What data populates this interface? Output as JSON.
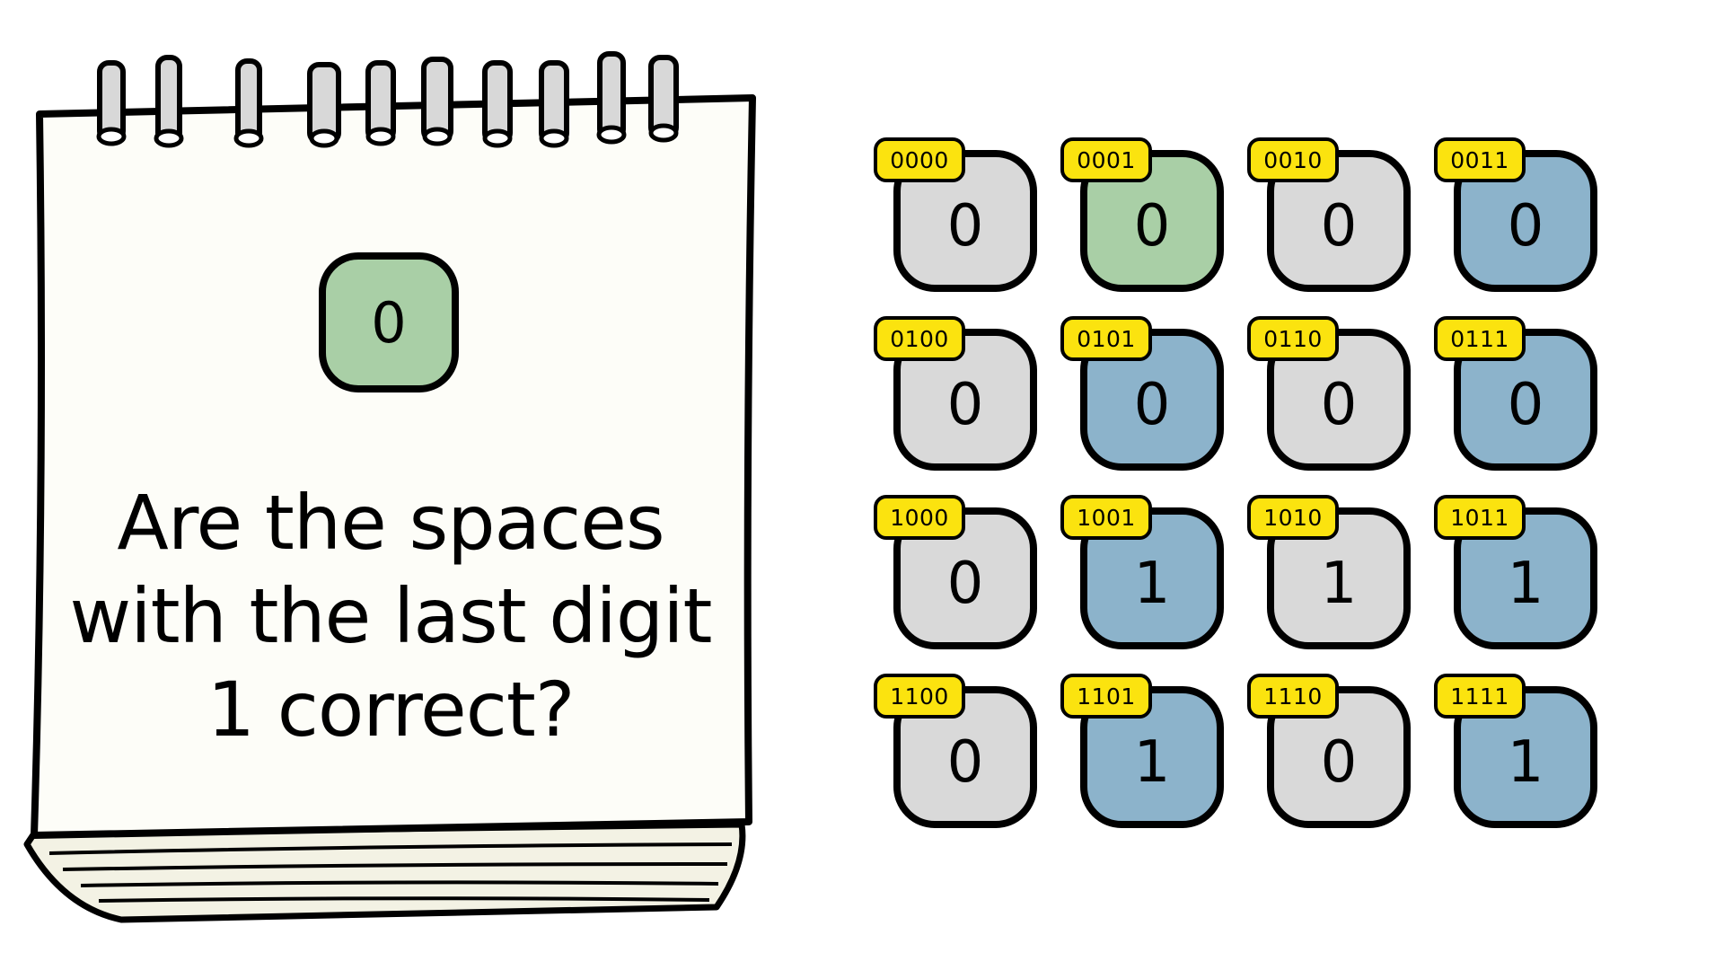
{
  "colors": {
    "gray": "#d9d9d9",
    "blue": "#8cb3cb",
    "green": "#a9cfa6",
    "badge_yellow": "#fbe30f",
    "paper": "#fdfdf8",
    "page_edges": "#f3f2e4"
  },
  "notebook": {
    "selected_value": "0",
    "selected_color": "green",
    "question_lines": [
      "Are the spaces",
      "with the last digit",
      "1 correct?"
    ]
  },
  "grid": {
    "cells": [
      {
        "label": "0000",
        "value": "0",
        "color": "gray"
      },
      {
        "label": "0001",
        "value": "0",
        "color": "green"
      },
      {
        "label": "0010",
        "value": "0",
        "color": "gray"
      },
      {
        "label": "0011",
        "value": "0",
        "color": "blue"
      },
      {
        "label": "0100",
        "value": "0",
        "color": "gray"
      },
      {
        "label": "0101",
        "value": "0",
        "color": "blue"
      },
      {
        "label": "0110",
        "value": "0",
        "color": "gray"
      },
      {
        "label": "0111",
        "value": "0",
        "color": "blue"
      },
      {
        "label": "1000",
        "value": "0",
        "color": "gray"
      },
      {
        "label": "1001",
        "value": "1",
        "color": "blue"
      },
      {
        "label": "1010",
        "value": "1",
        "color": "gray"
      },
      {
        "label": "1011",
        "value": "1",
        "color": "blue"
      },
      {
        "label": "1100",
        "value": "0",
        "color": "gray"
      },
      {
        "label": "1101",
        "value": "1",
        "color": "blue"
      },
      {
        "label": "1110",
        "value": "0",
        "color": "gray"
      },
      {
        "label": "1111",
        "value": "1",
        "color": "blue"
      }
    ]
  }
}
